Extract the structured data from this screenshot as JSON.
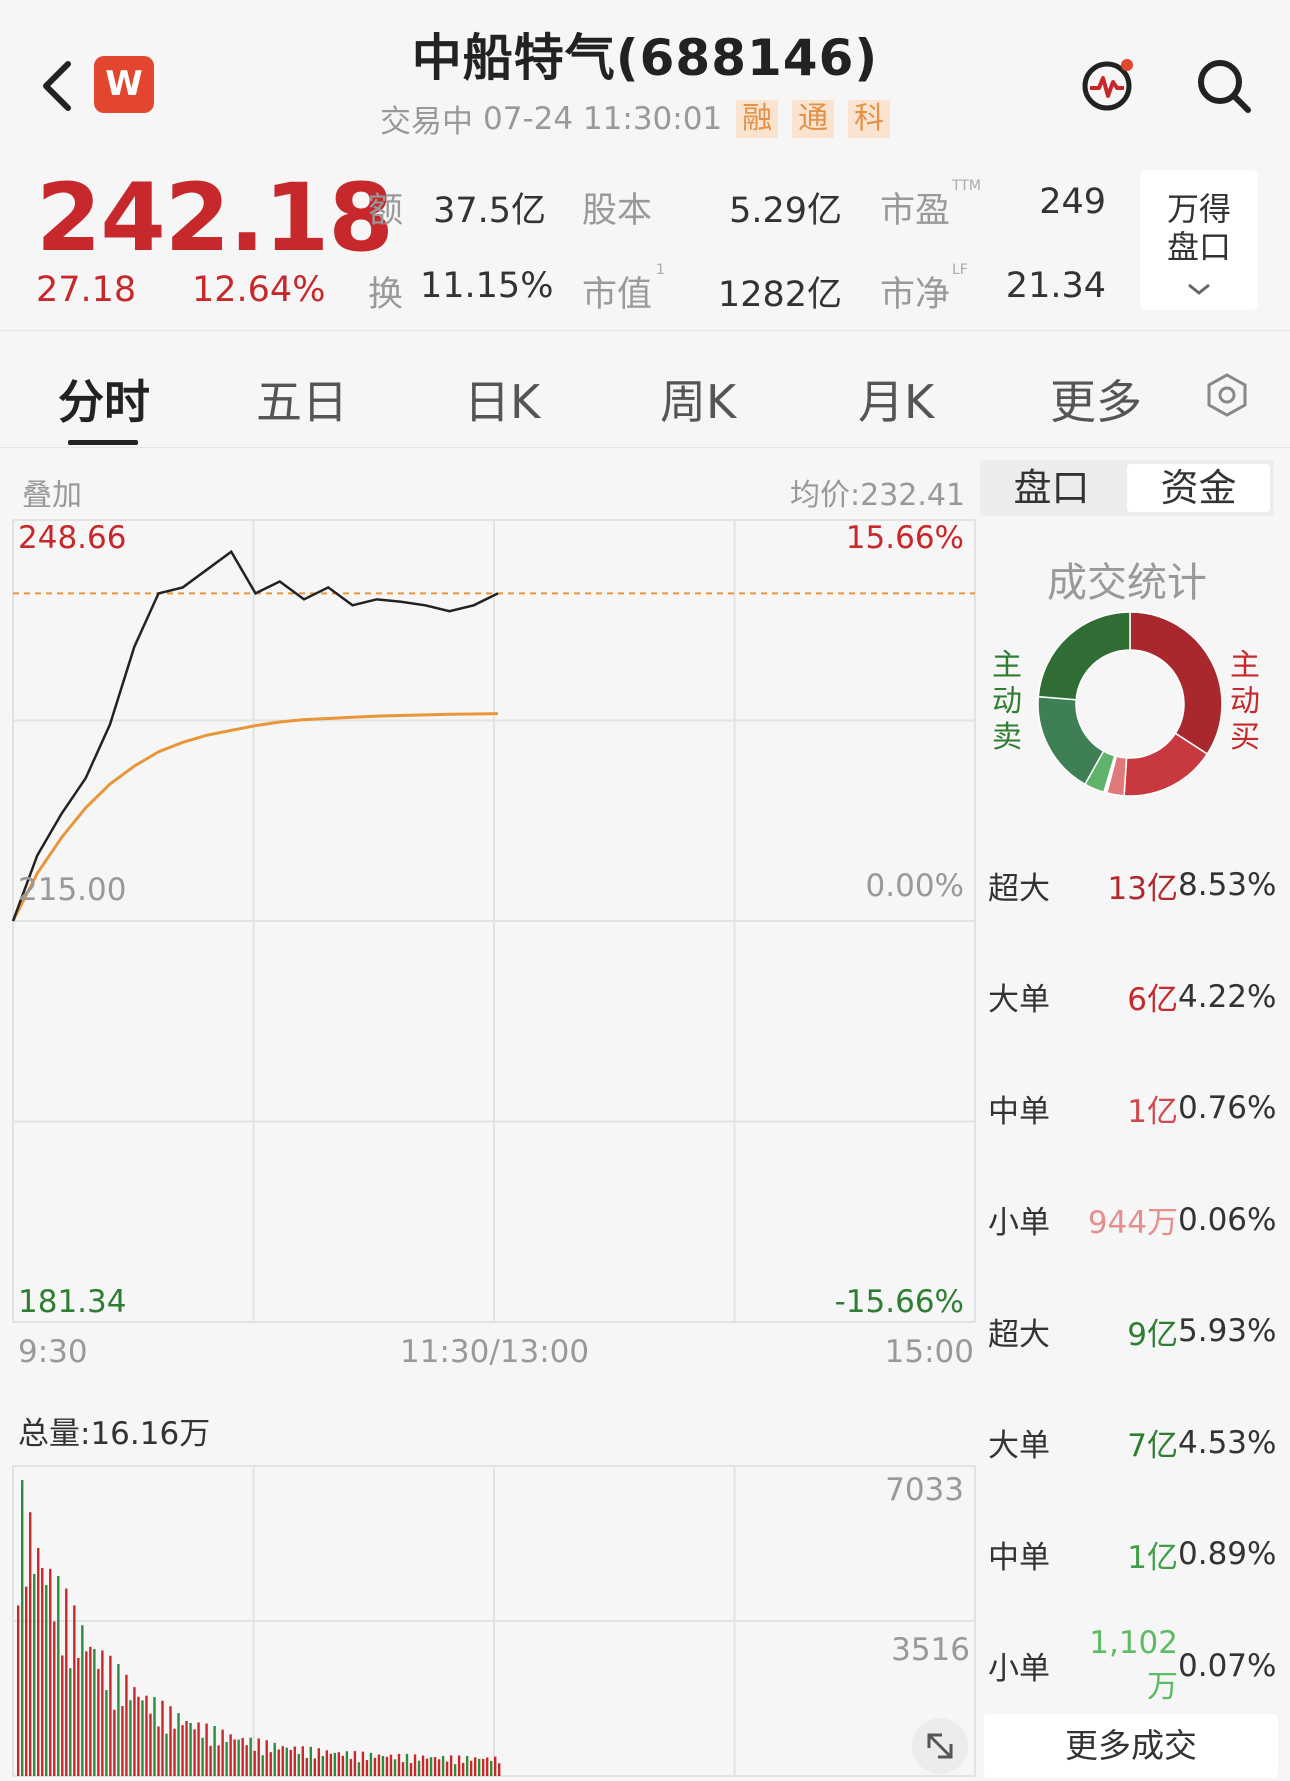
{
  "header": {
    "title": "中船特气(688146)",
    "status": "交易中",
    "datetime": "07-24 11:30:01",
    "tags": [
      "融",
      "通",
      "科"
    ],
    "logo_text": "W"
  },
  "quote": {
    "price": "242.18",
    "change": "27.18",
    "change_pct": "12.64%",
    "stats": [
      {
        "label": "额",
        "sup": "",
        "value": "37.5亿"
      },
      {
        "label": "股本",
        "sup": "",
        "value": "5.29亿"
      },
      {
        "label": "市盈",
        "sup": "TTM",
        "value": "249"
      },
      {
        "label": "换",
        "sup": "",
        "value": "11.15%"
      },
      {
        "label": "市值",
        "sup": "1",
        "value": "1282亿"
      },
      {
        "label": "市净",
        "sup": "LF",
        "value": "21.34"
      }
    ],
    "wind_button": [
      "万得",
      "盘口"
    ]
  },
  "tabs": [
    "分时",
    "五日",
    "日K",
    "周K",
    "月K",
    "更多"
  ],
  "chart": {
    "overlay_label": "叠加",
    "avg_price_label": "均价:232.41",
    "y_top": "248.66",
    "y_mid": "215.00",
    "y_bottom": "181.34",
    "pct_top": "15.66%",
    "pct_mid": "0.00%",
    "pct_bottom": "-15.66%",
    "time_start": "9:30",
    "time_mid": "11:30/13:00",
    "time_end": "15:00",
    "volume_total": "总量:16.16万",
    "vol_top": "7033",
    "vol_mid": "3516",
    "colors": {
      "price_line": "#222222",
      "avg_line": "#e8963a",
      "up": "#c6282c",
      "down": "#2e8b3a"
    }
  },
  "chart_data": {
    "type": "line",
    "title": "",
    "xlabel": "",
    "ylabel": "",
    "ylim": [
      181.34,
      248.66
    ],
    "x": [
      "9:30",
      "11:30"
    ],
    "series": [
      {
        "values": [
          215.0,
          220.5,
          224.0,
          227.0,
          231.5,
          238.0,
          242.5,
          243.0,
          244.5,
          246.0,
          242.5,
          243.5,
          242.0,
          243.0,
          241.5,
          242.0,
          241.8,
          241.5,
          241.0,
          241.5,
          242.5
        ]
      },
      {
        "values": [
          215.0,
          219.0,
          222.0,
          224.5,
          226.5,
          228.0,
          229.2,
          230.0,
          230.6,
          231.0,
          231.4,
          231.7,
          231.9,
          232.0,
          232.1,
          232.2,
          232.25,
          232.3,
          232.35,
          232.38,
          232.41
        ]
      }
    ],
    "volume_ylim": [
      0,
      7033
    ]
  },
  "right_panel": {
    "tabs": [
      "盘口",
      "资金"
    ],
    "title": "成交统计",
    "buy_label": "主动买",
    "sell_label": "主动卖",
    "donut": [
      {
        "name": "buy-xl",
        "value": 8.53,
        "color": "#a8282e"
      },
      {
        "name": "buy-l",
        "value": 4.22,
        "color": "#c7393f"
      },
      {
        "name": "buy-m",
        "value": 0.76,
        "color": "#e07a7a"
      },
      {
        "name": "buy-s",
        "value": 0.06,
        "color": "#f0b3b3"
      },
      {
        "name": "sell-s",
        "value": 0.07,
        "color": "#9fd3a6"
      },
      {
        "name": "sell-m",
        "value": 0.89,
        "color": "#5fb36b"
      },
      {
        "name": "sell-l",
        "value": 4.53,
        "color": "#3f7f55"
      },
      {
        "name": "sell-xl",
        "value": 5.93,
        "color": "#2f6d34"
      }
    ],
    "rows": [
      {
        "label": "超大",
        "amount": "13亿",
        "pct": "8.53%",
        "color": "#b2282c"
      },
      {
        "label": "大单",
        "amount": "6亿",
        "pct": "4.22%",
        "color": "#c6282c"
      },
      {
        "label": "中单",
        "amount": "1亿",
        "pct": "0.76%",
        "color": "#d0484c"
      },
      {
        "label": "小单",
        "amount": "944万",
        "pct": "0.06%",
        "color": "#e58f8f"
      },
      {
        "label": "超大",
        "amount": "9亿",
        "pct": "5.93%",
        "color": "#2e7d32"
      },
      {
        "label": "大单",
        "amount": "7亿",
        "pct": "4.53%",
        "color": "#2e7d32"
      },
      {
        "label": "中单",
        "amount": "1亿",
        "pct": "0.89%",
        "color": "#3f9f47"
      },
      {
        "label": "小单",
        "amount": "1,102万",
        "pct": "0.07%",
        "color": "#5dbb66"
      }
    ],
    "more_button": "更多成交"
  }
}
